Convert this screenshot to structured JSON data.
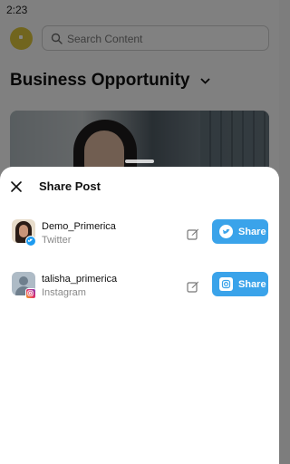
{
  "status_bar": {
    "time": "2:23"
  },
  "search": {
    "placeholder": "Search Content"
  },
  "page": {
    "title": "Business Opportunity"
  },
  "share_sheet": {
    "title": "Share Post",
    "accounts": [
      {
        "name": "Demo_Primerica",
        "network": "Twitter",
        "avatar": "user-photo",
        "network_icon": "twitter-icon",
        "share_label": "Share"
      },
      {
        "name": "talisha_primerica",
        "network": "Instagram",
        "avatar": "default-avatar",
        "network_icon": "instagram-icon",
        "share_label": "Share"
      }
    ]
  },
  "colors": {
    "share_button": "#3aa3ea",
    "twitter": "#1d9bf0",
    "logo": "#d8c23a"
  }
}
